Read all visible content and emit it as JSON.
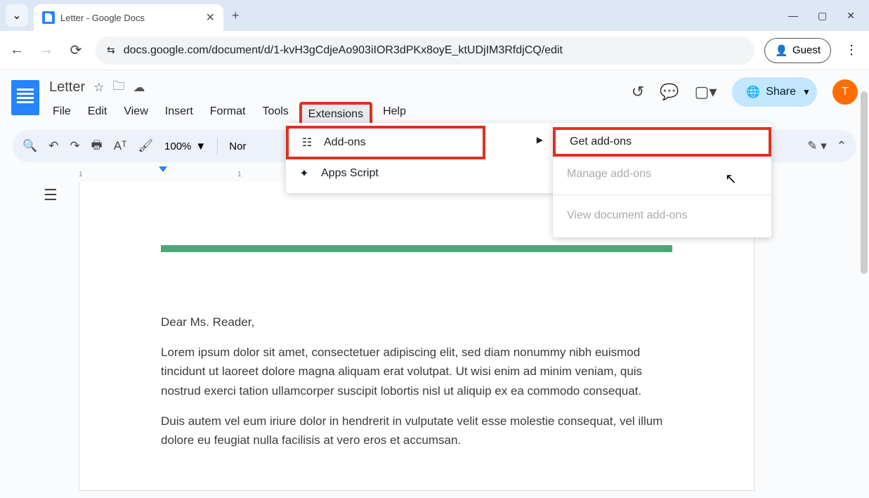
{
  "browser": {
    "tab_title": "Letter - Google Docs",
    "url": "docs.google.com/document/d/1-kvH3gCdjeAo903iIOR3dPKx8oyE_ktUDjIM3RfdjCQ/edit",
    "guest_label": "Guest"
  },
  "header": {
    "doc_title": "Letter",
    "menus": {
      "file": "File",
      "edit": "Edit",
      "view": "View",
      "insert": "Insert",
      "format": "Format",
      "tools": "Tools",
      "extensions": "Extensions",
      "help": "Help"
    },
    "share_label": "Share",
    "avatar_initial": "T"
  },
  "toolbar": {
    "zoom": "100%",
    "style": "Nor"
  },
  "ext_menu": {
    "addons": "Add-ons",
    "apps_script": "Apps Script"
  },
  "sub_menu": {
    "get": "Get add-ons",
    "manage": "Manage add-ons",
    "view": "View document add-ons"
  },
  "ruler": {
    "n1": "1",
    "n2": "1"
  },
  "document": {
    "greeting": "Dear Ms. Reader,",
    "p1": "Lorem ipsum dolor sit amet, consectetuer adipiscing elit, sed diam nonummy nibh euismod tincidunt ut laoreet dolore magna aliquam erat volutpat. Ut wisi enim ad minim veniam, quis nostrud exerci tation ullamcorper suscipit lobortis nisl ut aliquip ex ea commodo consequat.",
    "p2": "Duis autem vel eum iriure dolor in hendrerit in vulputate velit esse molestie consequat, vel illum dolore eu feugiat nulla facilisis at vero eros et accumsan."
  }
}
